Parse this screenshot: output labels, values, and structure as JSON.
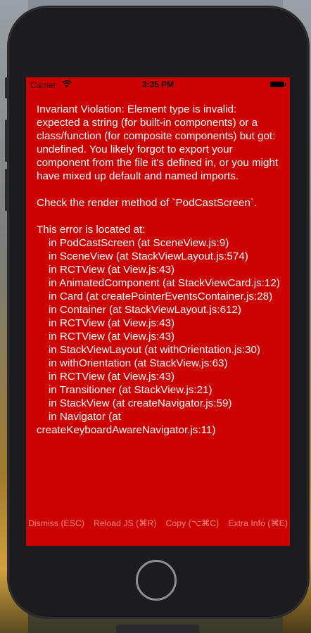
{
  "status_bar": {
    "carrier": "Carrier",
    "time": "3:35 PM"
  },
  "error": {
    "message": "Invariant Violation: Element type is invalid: expected a string (for built-in components) or a class/function (for composite components) but got: undefined. You likely forgot to export your component from the file it's defined in, or you might have mixed up default and named imports.\n\nCheck the render method of `PodCastScreen`.\n\nThis error is located at:\n    in PodCastScreen (at SceneView.js:9)\n    in SceneView (at StackViewLayout.js:574)\n    in RCTView (at View.js:43)\n    in AnimatedComponent (at StackViewCard.js:12)\n    in Card (at createPointerEventsContainer.js:28)\n    in Container (at StackViewLayout.js:612)\n    in RCTView (at View.js:43)\n    in RCTView (at View.js:43)\n    in StackViewLayout (at withOrientation.js:30)\n    in withOrientation (at StackView.js:63)\n    in RCTView (at View.js:43)\n    in Transitioner (at StackView.js:21)\n    in StackView (at createNavigator.js:59)\n    in Navigator (at createKeyboardAwareNavigator.js:11)"
  },
  "toolbar": {
    "dismiss": "Dismiss (ESC)",
    "reload": "Reload JS (⌘R)",
    "copy": "Copy (⌥⌘C)",
    "extra_info": "Extra Info (⌘E)"
  },
  "colors": {
    "error_background": "#cc0000",
    "toolbar_text": "#ff8a8a",
    "phone_body": "#1c1c1e"
  }
}
